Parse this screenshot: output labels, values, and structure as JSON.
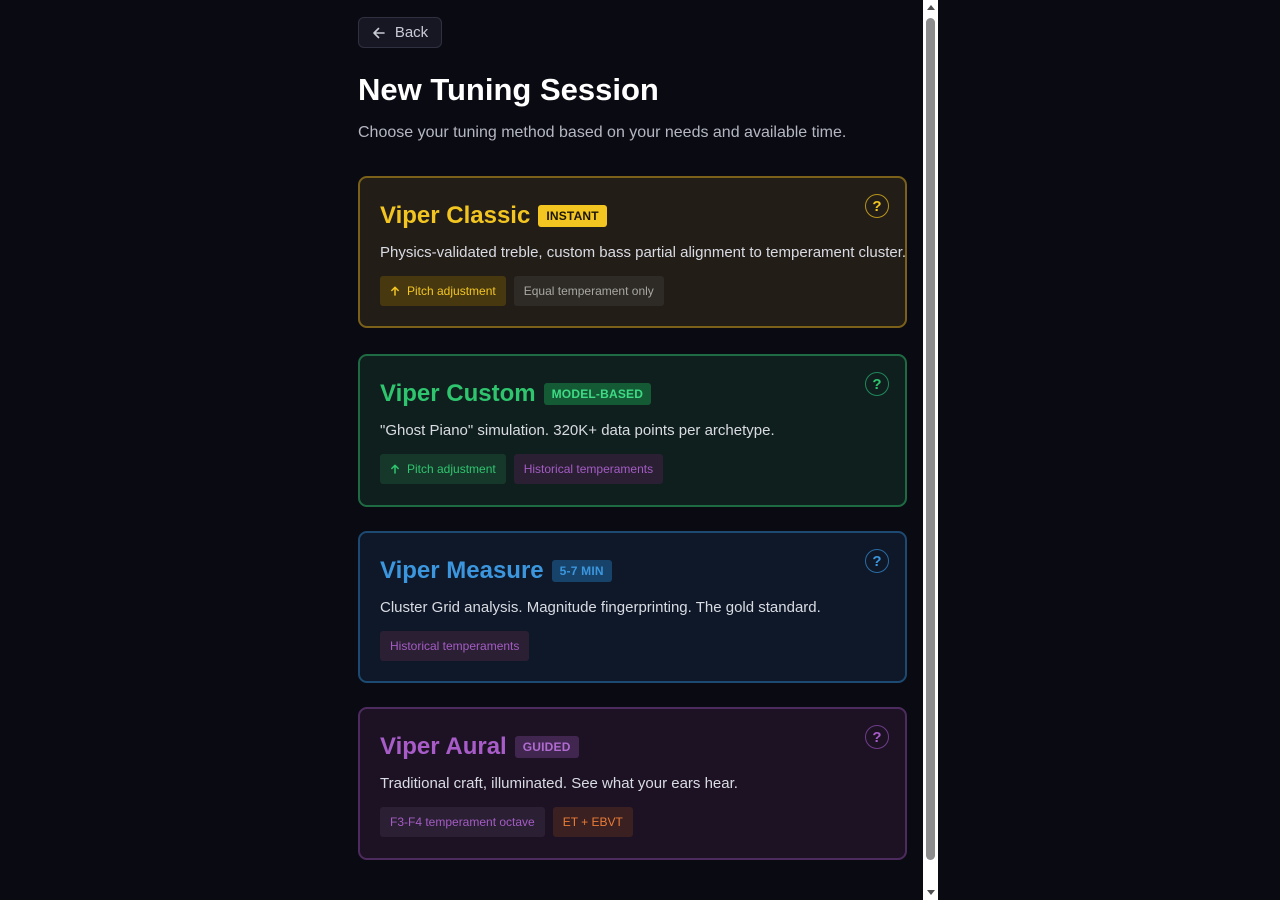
{
  "nav": {
    "back_label": "Back"
  },
  "header": {
    "title": "New Tuning Session",
    "subtitle": "Choose your tuning method based on your needs and available time."
  },
  "cards": [
    {
      "title": "Viper Classic",
      "badge": "INSTANT",
      "description": "Physics-validated treble, custom bass partial alignment to temperament cluster.",
      "help": "?",
      "tags": [
        "Pitch adjustment",
        "Equal temperament only"
      ]
    },
    {
      "title": "Viper Custom",
      "badge": "MODEL-BASED",
      "description": "\"Ghost Piano\" simulation. 320K+ data points per archetype.",
      "help": "?",
      "tags": [
        "Pitch adjustment",
        "Historical temperaments"
      ]
    },
    {
      "title": "Viper Measure",
      "badge": "5-7 MIN",
      "description": "Cluster Grid analysis. Magnitude fingerprinting. The gold standard.",
      "help": "?",
      "tags": [
        "Historical temperaments"
      ]
    },
    {
      "title": "Viper Aural",
      "badge": "GUIDED",
      "description": "Traditional craft, illuminated. See what your ears hear.",
      "help": "?",
      "tags": [
        "F3-F4 temperament octave",
        "ET + EBVT"
      ]
    }
  ],
  "colors": {
    "background": "#0a0a12",
    "classic": "#f2c521",
    "custom": "#2fc46e",
    "measure": "#3b96de",
    "aural": "#a75cc8",
    "orange_tag": "#ea7c36"
  },
  "icons": {
    "back": "arrow-left-icon",
    "pitch": "arrow-up-icon",
    "help": "question-mark-icon"
  }
}
